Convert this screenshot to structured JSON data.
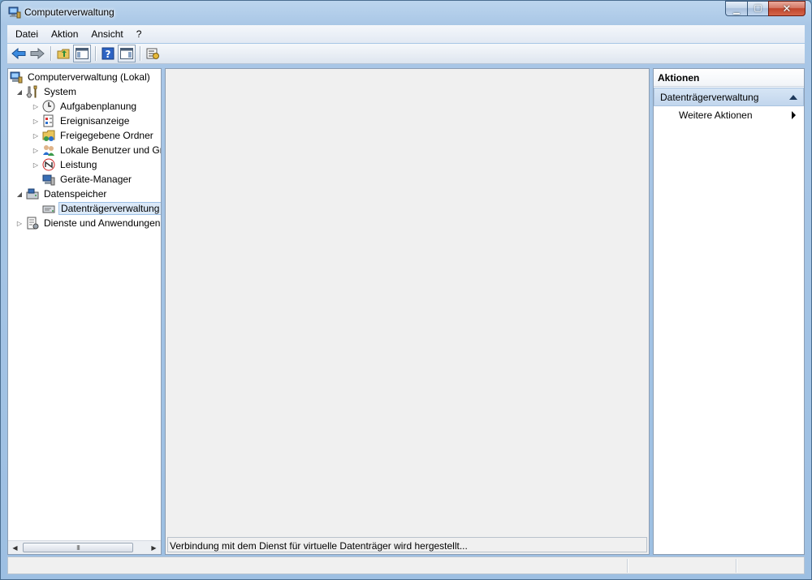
{
  "window": {
    "title": "Computerverwaltung",
    "icon": "computer-management-icon"
  },
  "menu": [
    "Datei",
    "Aktion",
    "Ansicht",
    "?"
  ],
  "toolbar": [
    "back-arrow-icon",
    "forward-arrow-icon",
    "up-folder-icon",
    "show-hide-console-tree-icon",
    "help-icon",
    "show-hide-action-pane-icon",
    "properties-icon"
  ],
  "tree": {
    "root": "Computerverwaltung (Lokal)",
    "system": "System",
    "aufgaben": "Aufgabenplanung",
    "ereignis": "Ereignisanzeige",
    "freigabe": "Freigegebene Ordner",
    "benutzer": "Lokale Benutzer und Gruppen",
    "leistung": "Leistung",
    "geraete": "Geräte-Manager",
    "speicher": "Datenspeicher",
    "datentraeger": "Datenträgerverwaltung",
    "dienste": "Dienste und Anwendungen"
  },
  "center": {
    "status": "Verbindung mit dem Dienst für virtuelle Datenträger wird hergestellt..."
  },
  "actions": {
    "header": "Aktionen",
    "group": "Datenträgerverwaltung",
    "more": "Weitere Aktionen"
  },
  "colors": {
    "selection": "#dbe9f8",
    "action_group": "#c8daf0",
    "title_glass": "#a9c7e6",
    "close_button": "#c0452c"
  }
}
